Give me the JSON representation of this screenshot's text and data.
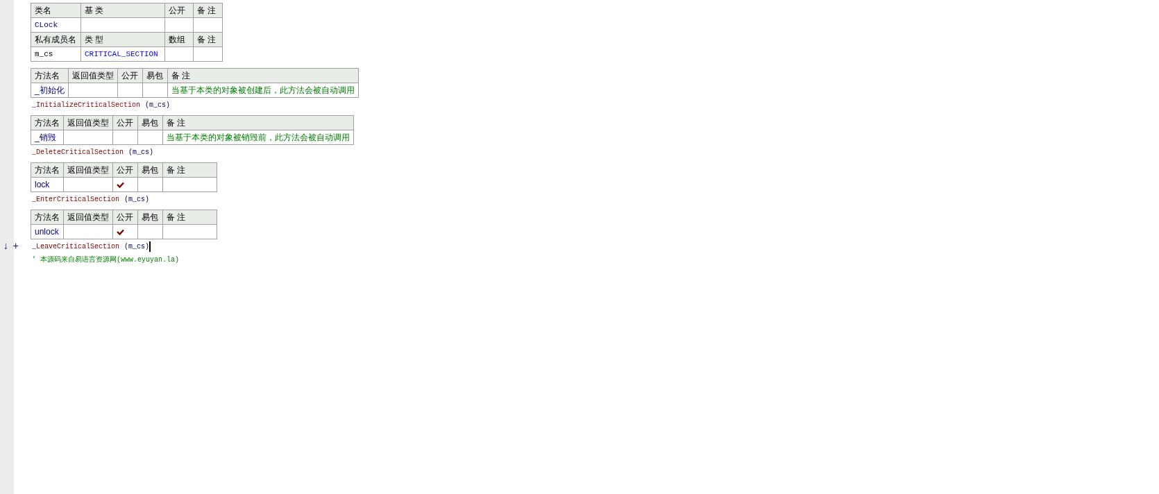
{
  "class_table": {
    "headers": [
      "类名",
      "基 类",
      "公开",
      "备 注"
    ],
    "row": {
      "name": "CLock"
    },
    "member_headers": [
      "私有成员名",
      "类 型",
      "数组",
      "备 注"
    ],
    "members": [
      {
        "name": "m_cs",
        "type": "CRITICAL_SECTION"
      }
    ]
  },
  "methods": [
    {
      "headers": [
        "方法名",
        "返回值类型",
        "公开",
        "易包",
        "备 注"
      ],
      "name": "_初始化",
      "public": false,
      "remark": "当基于本类的对象被创建后，此方法会被自动调用",
      "body": [
        {
          "call": "_InitializeCriticalSection",
          "args": "(m_cs)",
          "cursor": false
        }
      ]
    },
    {
      "headers": [
        "方法名",
        "返回值类型",
        "公开",
        "易包",
        "备 注"
      ],
      "name": "_销毁",
      "public": false,
      "remark": "当基于本类的对象被销毁前，此方法会被自动调用",
      "body": [
        {
          "call": "_DeleteCriticalSection",
          "args": "(m_cs)",
          "cursor": false
        }
      ]
    },
    {
      "headers": [
        "方法名",
        "返回值类型",
        "公开",
        "易包",
        "备 注"
      ],
      "name": "lock",
      "public": true,
      "body": [
        {
          "call": "_EnterCriticalSection",
          "args": "(m_cs)",
          "cursor": false
        }
      ]
    },
    {
      "headers": [
        "方法名",
        "返回值类型",
        "公开",
        "易包",
        "备 注"
      ],
      "name": "unlock",
      "public": true,
      "body": [
        {
          "call": "_LeaveCriticalSection",
          "args": "(m_cs)",
          "cursor": true,
          "gutter": [
            "↓",
            "+"
          ]
        }
      ]
    }
  ],
  "comment": "' 本源码来自易语言资源网(www.eyuyan.la)"
}
